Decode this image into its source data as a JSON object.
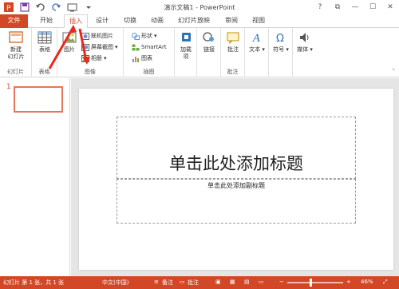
{
  "titlebar": {
    "title": "演示文稿1 - PowerPoint",
    "quick_access": [
      "powerpoint-logo-icon",
      "save-icon",
      "undo-icon",
      "redo-icon",
      "start-from-beginning-icon",
      "customize-qat-icon"
    ],
    "window_buttons": [
      "?",
      "⧉",
      "—",
      "☐",
      "✕"
    ]
  },
  "tabs": {
    "file": "文件",
    "home": "开始",
    "insert": "插入",
    "design": "设计",
    "transitions": "切换",
    "animations": "动画",
    "slideshow": "幻灯片放映",
    "review": "审阅",
    "view": "视图"
  },
  "ribbon": {
    "slides": {
      "new_slide": "新建\n幻灯片",
      "group": "幻灯片"
    },
    "tables": {
      "table": "表格",
      "group": "表格"
    },
    "images": {
      "pictures": "图片",
      "online_pictures": "联机图片",
      "screenshot": "屏幕截图",
      "photo_album": "相册",
      "group": "图像"
    },
    "illustrations": {
      "shapes": "形状",
      "smartart": "SmartArt",
      "chart": "图表",
      "group": "插图"
    },
    "apps": {
      "addins": "加载\n项"
    },
    "links": {
      "link": "链接"
    },
    "comments": {
      "comment": "批注",
      "group": "批注"
    },
    "text": {
      "text": "文本"
    },
    "symbols": {
      "symbol": "符号"
    },
    "media": {
      "media": "媒体"
    }
  },
  "slides_pane": {
    "slide_number": "1"
  },
  "slide": {
    "title_placeholder": "单击此处添加标题",
    "subtitle_placeholder": "单击此处添加副标题"
  },
  "statusbar": {
    "slide_info": "幻灯片 第 1 张，共 1 张",
    "language": "中文(中国)",
    "notes": "备注",
    "comments": "批注",
    "zoom": "46%"
  },
  "colors": {
    "accent": "#d24726",
    "ribbon_bg": "#ffffff",
    "workspace_bg": "#e5e5e5"
  }
}
